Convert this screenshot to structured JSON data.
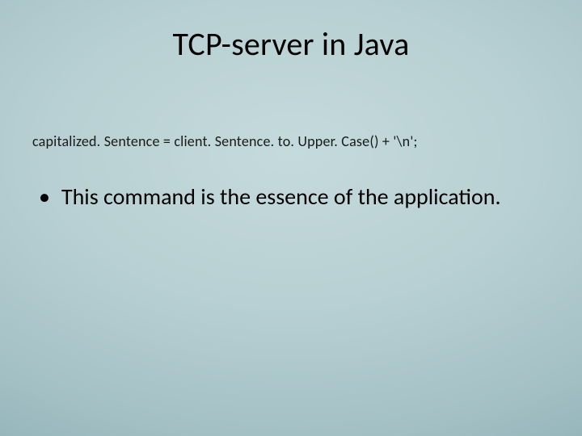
{
  "slide": {
    "title": "TCP-server in Java",
    "code_line": "capitalized. Sentence = client. Sentence. to. Upper. Case() + '\\n';",
    "bullets": [
      {
        "text": "This command is the essence of the application."
      }
    ]
  }
}
